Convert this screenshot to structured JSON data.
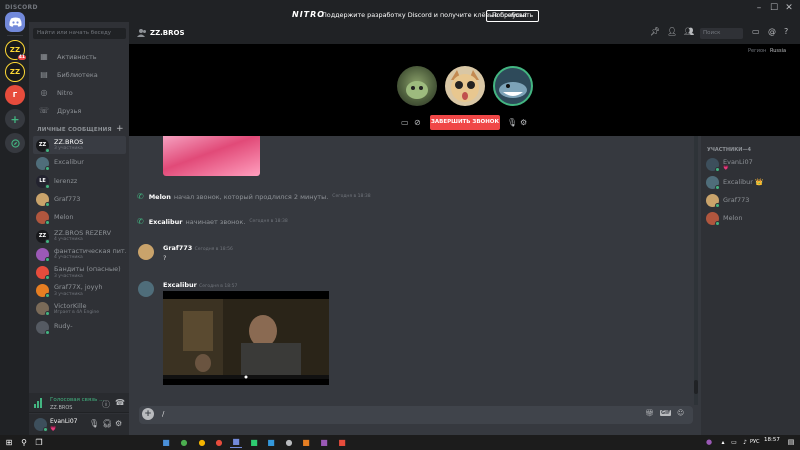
{
  "titlebar": {
    "app_name": "DISCORD",
    "nitro_logo": "NITRO",
    "nitro_text": "Поддержите разработку Discord и получите клёвые бонусы!",
    "nitro_button": "Попробовать"
  },
  "servers": [
    {
      "label": "ZZ",
      "badge": "41"
    },
    {
      "label": "ZZ"
    },
    {
      "label": "Г"
    }
  ],
  "sidebar": {
    "search_placeholder": "Найти или начать беседу",
    "nav": [
      {
        "label": "Активность",
        "icon": "gamepad-icon"
      },
      {
        "label": "Библиотека",
        "icon": "library-icon"
      },
      {
        "label": "Nitro",
        "icon": "nitro-icon"
      },
      {
        "label": "Друзья",
        "icon": "friends-icon"
      }
    ],
    "dm_header": "ЛИЧНЫЕ СООБЩЕНИЯ",
    "dms": [
      {
        "name": "ZZ.BROS",
        "sub": "3 участника",
        "color": "#18191c",
        "initials": "ZZ",
        "selected": true
      },
      {
        "name": "Excalibur",
        "sub": "",
        "color": "#4f6d7a",
        "initials": ""
      },
      {
        "name": "lerenzz",
        "sub": "",
        "color": "#23232f",
        "initials": "LE"
      },
      {
        "name": "Graf773",
        "sub": "",
        "color": "#c9a36b",
        "initials": ""
      },
      {
        "name": "Melon",
        "sub": "",
        "color": "#b0563e",
        "initials": ""
      },
      {
        "name": "ZZ.BROS REZERV",
        "sub": "4 участника",
        "color": "#18191c",
        "initials": "ZZ"
      },
      {
        "name": "фантастическая пит...",
        "sub": "4 участника",
        "color": "#9b59b6",
        "initials": ""
      },
      {
        "name": "Бандиты (опасные)",
        "sub": "3 участника",
        "color": "#e74c3c",
        "initials": ""
      },
      {
        "name": "Graf77X, joyyh",
        "sub": "3 участника",
        "color": "#e67e22",
        "initials": ""
      },
      {
        "name": "VictorKille",
        "sub": "Играет в 4A Engine",
        "color": "#7a6a58",
        "initials": ""
      },
      {
        "name": "Rudy-",
        "sub": "",
        "color": "#555a62",
        "initials": ""
      }
    ]
  },
  "voice": {
    "status": "Голосовая связь ...",
    "server": "ZZ.BROS"
  },
  "user": {
    "name": "EvanLi07",
    "tag": "💗"
  },
  "header": {
    "channel": "ZZ.BROS",
    "search_placeholder": "Поиск"
  },
  "call": {
    "region_label": "Регион",
    "region_value": "Russia",
    "end_button": "ЗАВЕРШИТЬ ЗВОНОК"
  },
  "chat": {
    "system": [
      {
        "actor": "Melon",
        "text": "начал звонок, который продлился 2 минуты.",
        "time": "Сегодня в 18:38"
      },
      {
        "actor": "Excalibur",
        "text": "начинает звонок.",
        "time": "Сегодня в 18:38"
      }
    ],
    "messages": [
      {
        "author": "Graf773",
        "time": "Сегодня в 18:56",
        "text": "?"
      },
      {
        "author": "Excalibur",
        "time": "Сегодня в 18:57",
        "text": ""
      }
    ]
  },
  "composer": {
    "value": "/"
  },
  "members": {
    "header": "УЧАСТНИКИ—4",
    "list": [
      {
        "name": "EvanLi07",
        "sub": "💗",
        "color": "#3d4f5c"
      },
      {
        "name": "Excalibur",
        "sub": "",
        "color": "#4f6d7a",
        "crown": "👑"
      },
      {
        "name": "Graf773",
        "sub": "",
        "color": "#c9a36b"
      },
      {
        "name": "Melon",
        "sub": "",
        "color": "#b0563e"
      }
    ]
  },
  "taskbar": {
    "lang": "РУС",
    "clock": "18:57"
  }
}
